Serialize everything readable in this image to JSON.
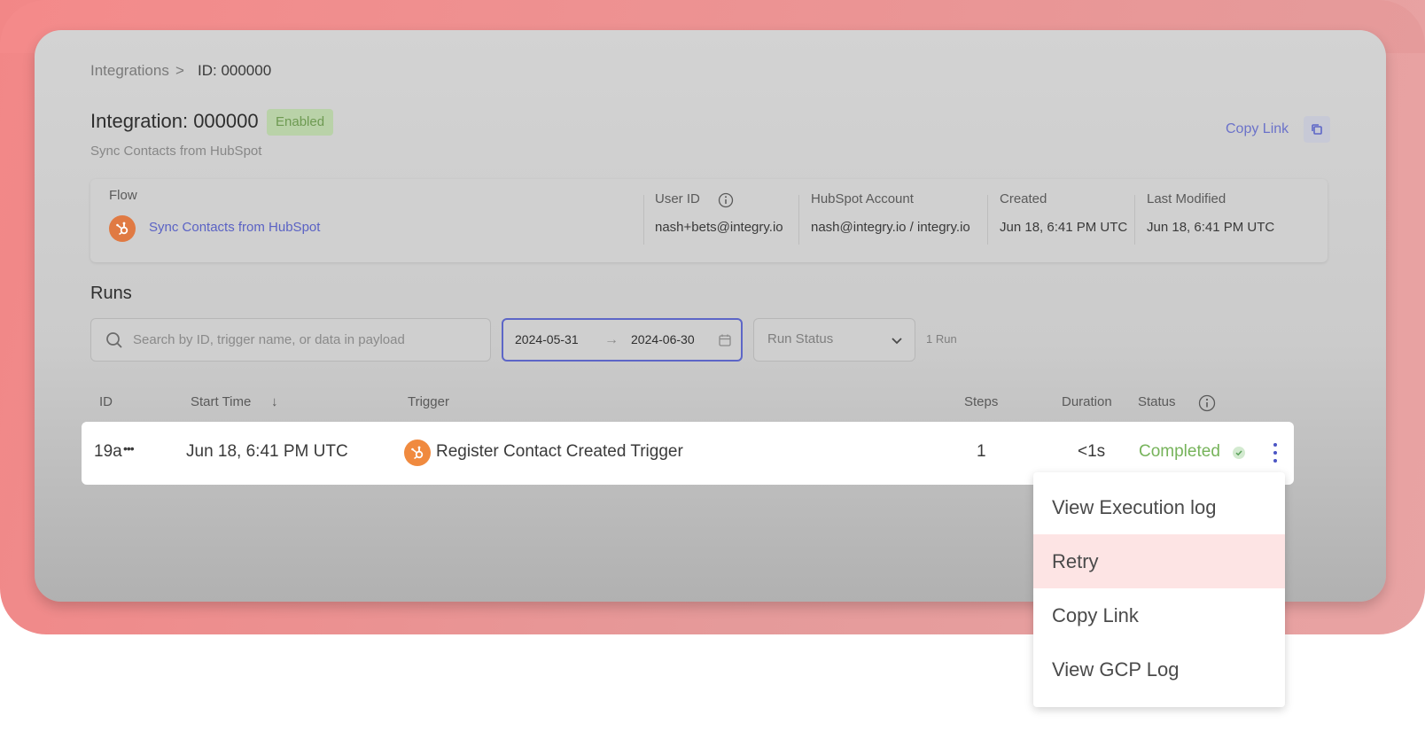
{
  "breadcrumb": {
    "root": "Integrations",
    "separator": ">",
    "current": "ID: 000000"
  },
  "header": {
    "title": "Integration: 000000",
    "badge": "Enabled",
    "subtitle": "Sync Contacts from HubSpot",
    "copy_link": "Copy Link"
  },
  "info": {
    "flow_label": "Flow",
    "flow_value": "Sync Contacts from HubSpot",
    "user_id_label": "User ID",
    "user_id_value": "nash+bets@integry.io",
    "account_label": "HubSpot Account",
    "account_value": "nash@integry.io / integry.io",
    "created_label": "Created",
    "created_value": "Jun 18, 6:41 PM UTC",
    "modified_label": "Last Modified",
    "modified_value": "Jun 18, 6:41 PM UTC"
  },
  "runs": {
    "title": "Runs",
    "search_placeholder": "Search by ID, trigger name, or data in payload",
    "date_start": "2024-05-31",
    "date_arrow": "→",
    "date_end": "2024-06-30",
    "status_placeholder": "Run Status",
    "count": "1 Run",
    "columns": {
      "id": "ID",
      "start_time": "Start Time",
      "sort_arrow": "↓",
      "trigger": "Trigger",
      "steps": "Steps",
      "duration": "Duration",
      "status": "Status"
    },
    "rows": [
      {
        "id": "19a",
        "ellipsis": "•••",
        "start_time": "Jun 18, 6:41 PM UTC",
        "trigger": "Register Contact Created Trigger",
        "steps": "1",
        "duration": "<1s",
        "status": "Completed"
      }
    ]
  },
  "menu": {
    "items": [
      "View Execution log",
      "Retry",
      "Copy Link",
      "View GCP Log"
    ],
    "active_index": 1
  },
  "colors": {
    "accent": "#5d66c7",
    "success": "#76b35a",
    "hubspot": "#f08a3f",
    "menu_hover": "#fde4e4"
  }
}
